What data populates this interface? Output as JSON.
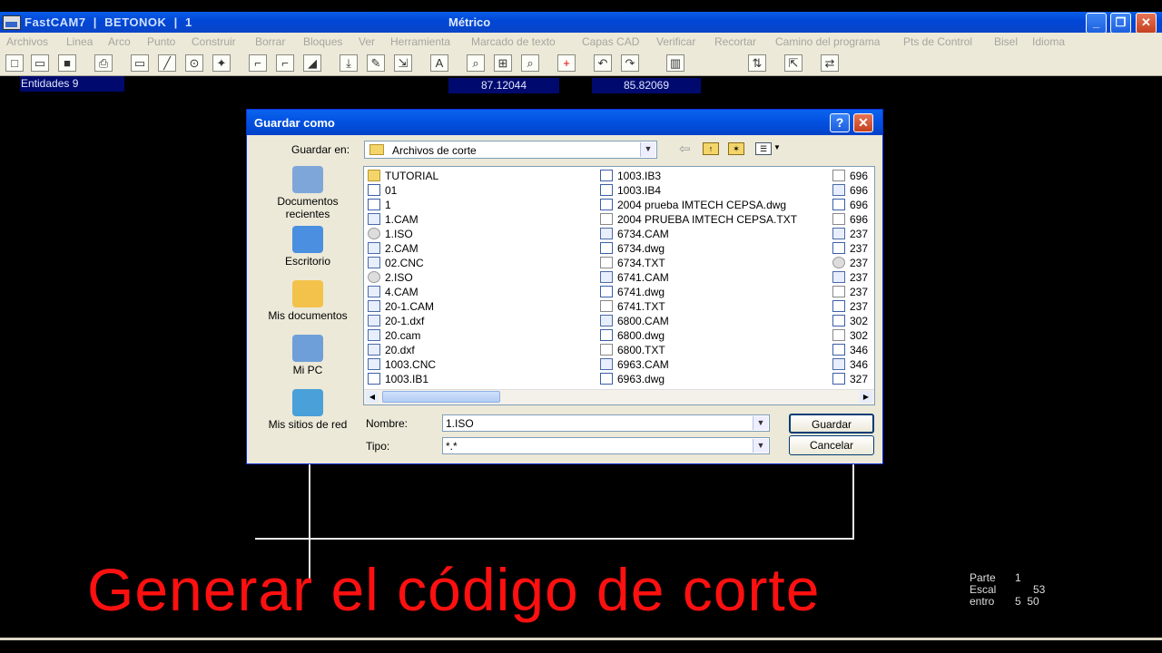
{
  "window": {
    "app_title": "FastCAM7  |  BETONOK  |  1",
    "center_title": "Métrico",
    "min_btn": "_",
    "max_btn": "❐",
    "close_btn": "✕"
  },
  "menu": [
    "Archivos",
    "Linea",
    "Arco",
    "Punto",
    "Construir",
    "Borrar",
    "Bloques",
    "Ver",
    "Herramienta",
    "Marcado de texto",
    "Capas CAD",
    "Verificar",
    "Recortar",
    "Camino del programa",
    "Pts de Control",
    "Bisel",
    "Idioma"
  ],
  "toolbar_glyphs": [
    "□",
    "▭",
    "■",
    "⎙",
    "▭",
    "╱",
    "⊙",
    "✦",
    "⌐",
    "⌐",
    "◢",
    "⤓",
    "✎",
    "⇲",
    "A",
    "⌕",
    "⊞",
    "⌕",
    "+",
    "↶",
    "↷",
    "▥",
    "⇅",
    "⇱",
    "⇄"
  ],
  "status": {
    "entities": "Entidades 9",
    "x": "87.12044",
    "y": "85.82069"
  },
  "dialog": {
    "title": "Guardar como",
    "help_btn": "?",
    "close_btn": "✕",
    "save_in_label": "Guardar en:",
    "save_in_value": "Archivos de corte",
    "places": [
      "Documentos recientes",
      "Escritorio",
      "Mis documentos",
      "Mi PC",
      "Mis sitios de red"
    ],
    "files_col1": [
      {
        "name": "TUTORIAL",
        "type": "folder"
      },
      {
        "name": "01",
        "type": "dwg"
      },
      {
        "name": "1",
        "type": "dwg"
      },
      {
        "name": "1.CAM",
        "type": "cam"
      },
      {
        "name": "1.ISO",
        "type": "cd"
      },
      {
        "name": "2.CAM",
        "type": "cam"
      },
      {
        "name": "02.CNC",
        "type": "cam"
      },
      {
        "name": "2.ISO",
        "type": "cd"
      },
      {
        "name": "4.CAM",
        "type": "cam"
      },
      {
        "name": "20-1.CAM",
        "type": "cam"
      },
      {
        "name": "20-1.dxf",
        "type": "cam"
      },
      {
        "name": "20.cam",
        "type": "cam"
      },
      {
        "name": "20.dxf",
        "type": "cam"
      },
      {
        "name": "1003.CNC",
        "type": "cam"
      },
      {
        "name": "1003.IB1",
        "type": "dwg"
      }
    ],
    "files_col2": [
      {
        "name": "1003.IB3",
        "type": "dwg"
      },
      {
        "name": "1003.IB4",
        "type": "dwg"
      },
      {
        "name": "2004 prueba IMTECH CEPSA.dwg",
        "type": "dwg"
      },
      {
        "name": "2004 PRUEBA IMTECH CEPSA.TXT",
        "type": "txt"
      },
      {
        "name": "6734.CAM",
        "type": "cam"
      },
      {
        "name": "6734.dwg",
        "type": "dwg"
      },
      {
        "name": "6734.TXT",
        "type": "txt"
      },
      {
        "name": "6741.CAM",
        "type": "cam"
      },
      {
        "name": "6741.dwg",
        "type": "dwg"
      },
      {
        "name": "6741.TXT",
        "type": "txt"
      },
      {
        "name": "6800.CAM",
        "type": "cam"
      },
      {
        "name": "6800.dwg",
        "type": "dwg"
      },
      {
        "name": "6800.TXT",
        "type": "txt"
      },
      {
        "name": "6963.CAM",
        "type": "cam"
      },
      {
        "name": "6963.dwg",
        "type": "dwg"
      }
    ],
    "files_col3": [
      {
        "name": "696",
        "type": "txt"
      },
      {
        "name": "696",
        "type": "cam"
      },
      {
        "name": "696",
        "type": "dwg"
      },
      {
        "name": "696",
        "type": "txt"
      },
      {
        "name": "237",
        "type": "cam"
      },
      {
        "name": "237",
        "type": "dwg"
      },
      {
        "name": "237",
        "type": "cd"
      },
      {
        "name": "237",
        "type": "cam"
      },
      {
        "name": "237",
        "type": "txt"
      },
      {
        "name": "237",
        "type": "dwg"
      },
      {
        "name": "302",
        "type": "dwg"
      },
      {
        "name": "302",
        "type": "txt"
      },
      {
        "name": "346",
        "type": "dwg"
      },
      {
        "name": "346",
        "type": "cam"
      },
      {
        "name": "327",
        "type": "dwg"
      }
    ],
    "name_label": "Nombre:",
    "name_value": "1.ISO",
    "type_label": "Tipo:",
    "type_value": "*.*",
    "save_button": "Guardar",
    "cancel_button": "Cancelar"
  },
  "side_info": {
    "parte_label": "Parte",
    "parte_value": "1",
    "line2": "Escal",
    "line2_value": "53",
    "line3": "entro",
    "line3_value": "5  50"
  },
  "caption": "Generar el código de corte"
}
